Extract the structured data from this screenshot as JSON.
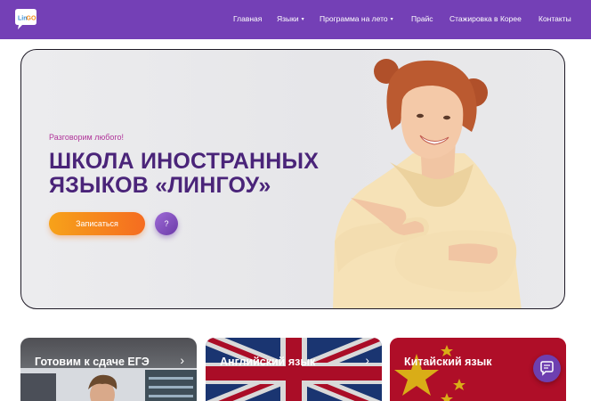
{
  "brand": {
    "logo_text": "LinGo",
    "logo_icon": "speech-bubble-logo"
  },
  "nav": {
    "items": [
      {
        "label": "Главная",
        "dropdown": false
      },
      {
        "label": "Языки",
        "dropdown": true
      },
      {
        "label": "Программа на лето",
        "dropdown": true
      },
      {
        "label": "Прайс",
        "dropdown": false
      },
      {
        "label": "Стажировка в Корее",
        "dropdown": false
      },
      {
        "label": "Контакты",
        "dropdown": false
      }
    ],
    "caret": "▾"
  },
  "hero": {
    "tagline": "Разговорим любого!",
    "title": "ШКОЛА ИНОСТРАННЫХ ЯЗЫКОВ «ЛИНГОУ»",
    "cta_label": "Записаться",
    "help_label": "?"
  },
  "cards": [
    {
      "title": "Готовим к сдаче ЕГЭ",
      "arrow": "›"
    },
    {
      "title": "Английский язык",
      "arrow": "›"
    },
    {
      "title": "Китайский язык"
    }
  ],
  "colors": {
    "brand_purple": "#7440b6",
    "title_purple": "#4a2479",
    "tagline_pink": "#b0359a",
    "cta_orange": "#f56c20"
  },
  "icons": {
    "chat": "chat-bubble-icon",
    "help": "question-icon",
    "arrow": "chevron-right-icon"
  }
}
